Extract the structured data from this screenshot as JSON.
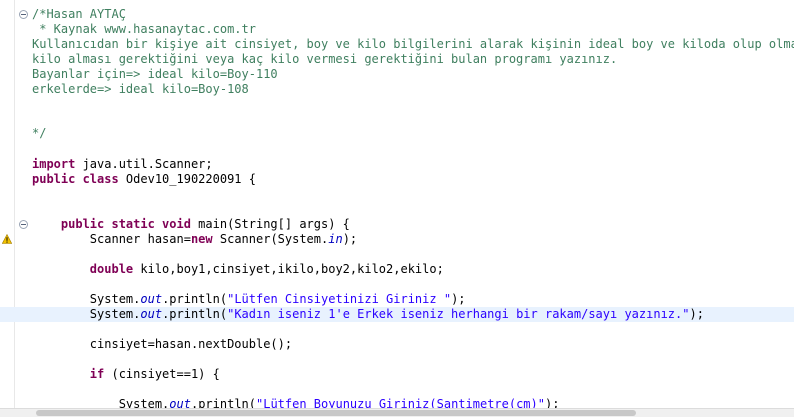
{
  "editor": {
    "lines": {
      "l1": "/*Hasan AYTAÇ",
      "l2": " * Kaynak www.hasanaytac.com.tr",
      "l3": "Kullanıcıdan bir kişiye ait cinsiyet, boy ve kilo bilgilerini alarak kişinin ideal boy ve kiloda olup olmadığını",
      "l4": "kilo alması gerektiğini veya kaç kilo vermesi gerektiğini bulan programı yazınız.",
      "l5": "Bayanlar için=> ideal kilo=Boy-110",
      "l6": "erkelerde=> ideal kilo=Boy-108",
      "l9": "*/",
      "l11a": "import",
      "l11b": " java.util.Scanner;",
      "l12a": "public class",
      "l12b": " Odev10_190220091 {",
      "l15a": "    public static void",
      "l15b": " main(String[] args) {",
      "l16a": "        Scanner hasan=",
      "l16b": "new",
      "l16c": " Scanner(System.",
      "l16d": "in",
      "l16e": ");",
      "l18a": "        double",
      "l18b": " kilo,boy1,cinsiyet,ikilo,boy2,kilo2,ekilo;",
      "l20a": "        System.",
      "l20b": "out",
      "l20c": ".println(",
      "l20d": "\"Lütfen Cinsiyetinizi Giriniz \"",
      "l20e": ");",
      "l21a": "        System.",
      "l21b": "out",
      "l21c": ".println(",
      "l21d": "\"Kadın iseniz 1'e Erkek iseniz herhangi bir rakam/sayı yazınız.\"",
      "l21e": ");",
      "l23": "        cinsiyet=hasan.nextDouble();",
      "l25a": "        if",
      "l25b": " (cinsiyet==1) {",
      "l27a": "            System.",
      "l27b": "out",
      "l27c": ".println(",
      "l27d": "\"Lütfen Boyunuzu Giriniz(Santimetre(cm)\"",
      "l27e": ");"
    }
  },
  "colors": {
    "comment": "#3f7f5f",
    "keyword": "#7f0055",
    "string": "#2a00ff",
    "static_field": "#0000c0",
    "current_line": "#e8f2fe"
  },
  "icons": [
    "fold-toggle-icon",
    "warning-icon"
  ]
}
